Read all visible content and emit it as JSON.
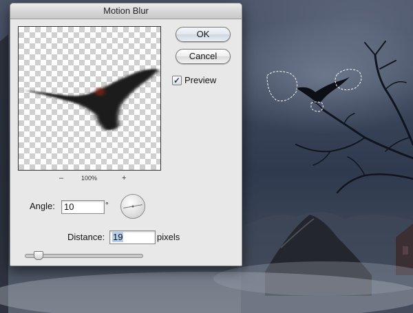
{
  "dialog": {
    "title": "Motion Blur",
    "ok_label": "OK",
    "cancel_label": "Cancel",
    "preview": {
      "checked": true,
      "label": "Preview",
      "check_glyph": "✓"
    },
    "zoom": {
      "minus": "–",
      "level": "100%",
      "plus": "+"
    },
    "angle": {
      "label": "Angle:",
      "value": "10",
      "unit": "°"
    },
    "distance": {
      "label": "Distance:",
      "value": "19",
      "unit": "pixels",
      "slider_fraction": 0.08
    }
  },
  "icons": {
    "zoom_out": "minus-icon",
    "zoom_in": "plus-icon",
    "angle_dial": "angle-dial-icon",
    "checkbox": "checkmark-icon"
  },
  "colors": {
    "dialog_bg": "#e8e8e8",
    "ok_button": "#dfe6ef",
    "selection": "#b5cdee",
    "marching_ants": "#ffffff"
  }
}
